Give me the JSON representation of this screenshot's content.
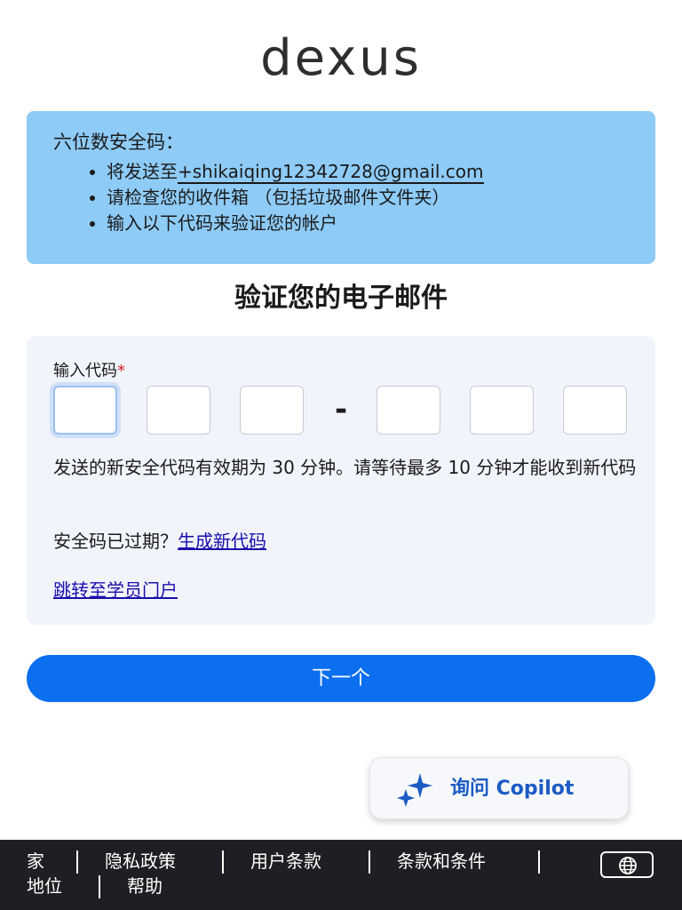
{
  "brand": {
    "logo_text": "dexus"
  },
  "info": {
    "title": "六位数安全码：",
    "items": [
      {
        "prefix": "将发送至",
        "email": "+shikaiqing12342728@gmail.com"
      },
      {
        "text": "请检查您的收件箱 （包括垃圾邮件文件夹）"
      },
      {
        "text": "输入以下代码来验证您的帐户"
      }
    ]
  },
  "heading": "验证您的电子邮件",
  "form": {
    "code_label": "输入代码",
    "required_mark": "*",
    "code_digits": [
      "",
      "",
      "",
      "",
      "",
      ""
    ],
    "separator": "-",
    "notice": "发送的新安全代码有效期为 30 分钟。请等待最多 10 分钟才能收到新代码",
    "expired_prompt": "安全码已过期？",
    "regenerate_link": "生成新代码",
    "portal_link": "跳转至学员门户"
  },
  "next_button": "下一个",
  "copilot": {
    "label": "询问 Copilot",
    "icon": "sparkle-icon",
    "icon_color": "#1c5bc4"
  },
  "footer": {
    "links": [
      "家",
      "隐私政策",
      "用户条款",
      "条款和条件",
      "地位",
      "帮助"
    ],
    "language_icon": "globe-icon"
  },
  "colors": {
    "info_bg": "#8ecbf7",
    "card_bg": "#f1f4fb",
    "primary": "#0b6ff0",
    "link": "#1a0dab",
    "footer_bg": "#1d1f22"
  }
}
